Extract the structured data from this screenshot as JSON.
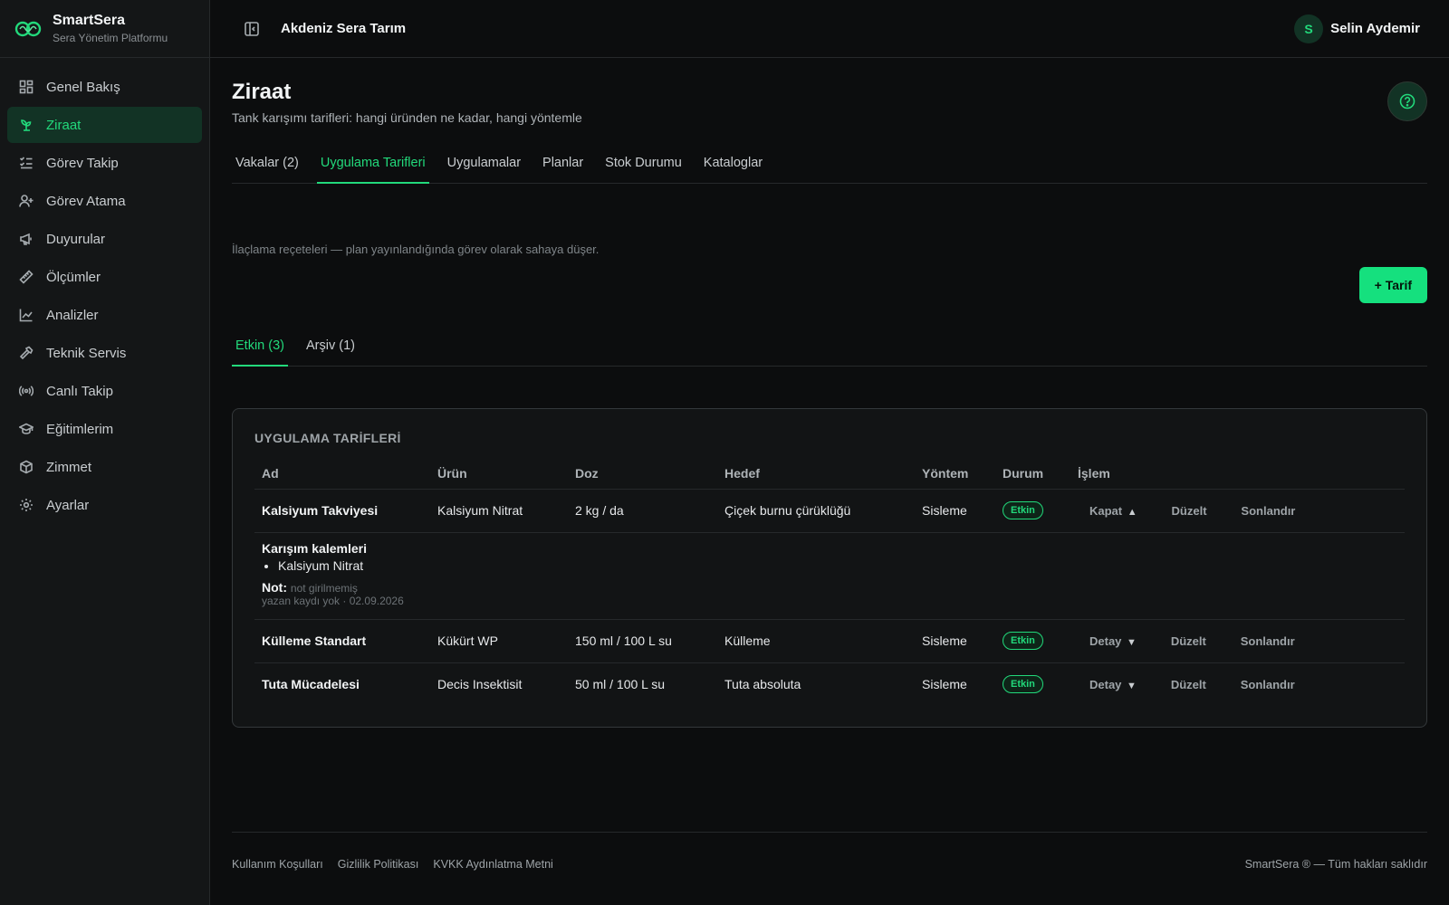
{
  "brand": {
    "name": "SmartSera",
    "subtitle": "Sera Yönetim Platformu",
    "accent": "#22d97b"
  },
  "sidebar": {
    "items": [
      {
        "label": "Genel Bakış",
        "icon": "dashboard-icon"
      },
      {
        "label": "Ziraat",
        "icon": "sprout-icon",
        "active": true
      },
      {
        "label": "Görev Takip",
        "icon": "checklist-icon"
      },
      {
        "label": "Görev Atama",
        "icon": "user-plus-icon"
      },
      {
        "label": "Duyurular",
        "icon": "megaphone-icon"
      },
      {
        "label": "Ölçümler",
        "icon": "ruler-icon"
      },
      {
        "label": "Analizler",
        "icon": "chart-line-icon"
      },
      {
        "label": "Teknik Servis",
        "icon": "hammer-icon"
      },
      {
        "label": "Canlı Takip",
        "icon": "radio-icon"
      },
      {
        "label": "Eğitimlerim",
        "icon": "graduation-cap-icon"
      },
      {
        "label": "Zimmet",
        "icon": "package-icon"
      },
      {
        "label": "Ayarlar",
        "icon": "gear-icon"
      }
    ]
  },
  "topbar": {
    "org_name": "Akdeniz Sera Tarım",
    "user_initial": "S",
    "user_name": "Selin Aydemir"
  },
  "page": {
    "title": "Ziraat",
    "subtitle": "Tank karışımı tarifleri: hangi üründen ne kadar, hangi yöntemle",
    "tabs": [
      "Vakalar (2)",
      "Uygulama Tarifleri",
      "Uygulamalar",
      "Planlar",
      "Stok Durumu",
      "Kataloglar"
    ],
    "active_tab": "Uygulama Tarifleri",
    "description": "İlaçlama reçeteleri — plan yayınlandığında görev olarak sahaya düşer.",
    "add_button": "+ Tarif",
    "subtabs": [
      "Etkin (3)",
      "Arşiv (1)"
    ]
  },
  "table": {
    "title": "UYGULAMA TARİFLERİ",
    "columns": [
      "Ad",
      "Ürün",
      "Doz",
      "Hedef",
      "Yöntem",
      "Durum",
      "İşlem"
    ],
    "rows": [
      {
        "name": "Kalsiyum Takviyesi",
        "product": "Kalsiyum Nitrat",
        "dose": "2 kg / da",
        "target": "Çiçek burnu çürüklüğü",
        "method": "Sisleme",
        "status": "Etkin",
        "toggle": "Kapat",
        "toggle_caret": "▲",
        "edit": "Düzelt",
        "finish": "Sonlandır"
      },
      {
        "name": "Külleme Standart",
        "product": "Kükürt WP",
        "dose": "150 ml / 100 L su",
        "target": "Külleme",
        "method": "Sisleme",
        "status": "Etkin",
        "toggle": "Detay",
        "toggle_caret": "▼",
        "edit": "Düzelt",
        "finish": "Sonlandır"
      },
      {
        "name": "Tuta Mücadelesi",
        "product": "Decis Insektisit",
        "dose": "50 ml / 100 L su",
        "target": "Tuta absoluta",
        "method": "Sisleme",
        "status": "Etkin",
        "toggle": "Detay",
        "toggle_caret": "▼",
        "edit": "Düzelt",
        "finish": "Sonlandır"
      }
    ],
    "detail": {
      "heading": "Karışım kalemleri",
      "items": [
        "Kalsiyum Nitrat"
      ],
      "note_label": "Not:",
      "note_value": "not girilmemiş",
      "meta": "yazan kaydı yok · 02.09.2026"
    }
  },
  "footer": {
    "links": [
      "Kullanım Koşulları",
      "Gizlilik Politikası",
      "KVKK Aydınlatma Metni"
    ],
    "copyright": "SmartSera ® — Tüm hakları saklıdır"
  }
}
